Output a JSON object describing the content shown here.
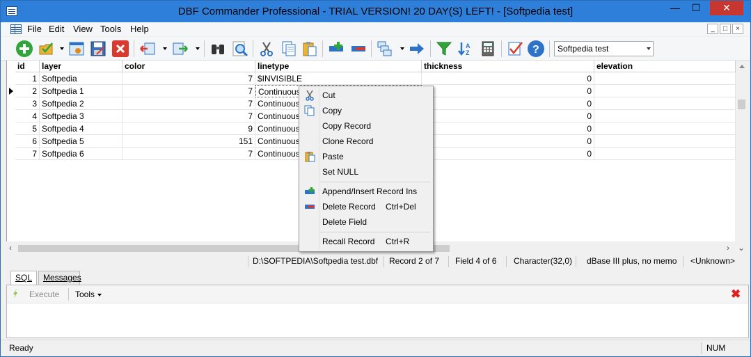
{
  "window": {
    "title": "DBF Commander Professional - TRIAL VERSION! 20 DAY(S) LEFT! - [Softpedia test]",
    "min_glyph": "—",
    "max_glyph": "☐",
    "close_glyph": "✕"
  },
  "menu": {
    "items": [
      "File",
      "Edit",
      "View",
      "Tools",
      "Help"
    ],
    "mdi": [
      "_",
      "□",
      "×"
    ]
  },
  "toolbar": {
    "table_select": "Softpedia test",
    "icons": [
      "new-record-icon",
      "open-icon",
      "properties-icon",
      "save-icon",
      "close-table-icon",
      "import-icon",
      "export-icon",
      "find-icon",
      "zoom-icon",
      "cut-icon",
      "copy-icon",
      "paste-icon",
      "append-record-icon",
      "delete-record-icon",
      "copy-structure-icon",
      "go-icon",
      "filter-icon",
      "sort-icon",
      "calculator-icon",
      "check-icon",
      "help-icon"
    ]
  },
  "grid": {
    "columns": [
      "id",
      "layer",
      "color",
      "linetype",
      "thickness",
      "elevation"
    ],
    "rows": [
      {
        "id": "1",
        "layer": "Softpedia",
        "color": "7",
        "linetype": "$INVISIBLE",
        "thickness": "0",
        "elevation": ""
      },
      {
        "id": "2",
        "layer": "Softpedia 1",
        "color": "7",
        "linetype": "Continuous",
        "thickness": "0",
        "elevation": ""
      },
      {
        "id": "3",
        "layer": "Softpedia 2",
        "color": "7",
        "linetype": "Continuous",
        "thickness": "0",
        "elevation": ""
      },
      {
        "id": "4",
        "layer": "Softpedia 3",
        "color": "7",
        "linetype": "Continuous",
        "thickness": "0",
        "elevation": ""
      },
      {
        "id": "5",
        "layer": "Softpedia 4",
        "color": "9",
        "linetype": "Continuous",
        "thickness": "0",
        "elevation": ""
      },
      {
        "id": "6",
        "layer": "Softpedia 5",
        "color": "151",
        "linetype": "Continuous",
        "thickness": "0",
        "elevation": ""
      },
      {
        "id": "7",
        "layer": "Softpedia 6",
        "color": "7",
        "linetype": "Continuous",
        "thickness": "0",
        "elevation": ""
      }
    ],
    "current_row": 2
  },
  "info": {
    "path": "D:\\SOFTPEDIA\\Softpedia test.dbf",
    "record": "Record 2 of 7",
    "field": "Field 4 of 6",
    "type": "Character(32,0)",
    "format": "dBase III plus, no memo",
    "codepage": "<Unknown>"
  },
  "lower": {
    "tabs": [
      "SQL",
      "Messages"
    ],
    "execute": "Execute",
    "tools": "Tools",
    "close_glyph": "✖"
  },
  "status": {
    "ready": "Ready",
    "num": "NUM"
  },
  "context_menu": {
    "items": [
      {
        "label": "Cut",
        "shortcut": "",
        "icon": "cut-icon"
      },
      {
        "label": "Copy",
        "shortcut": "",
        "icon": "copy-icon"
      },
      {
        "label": "Copy Record",
        "shortcut": "",
        "icon": ""
      },
      {
        "label": "Clone Record",
        "shortcut": "",
        "icon": ""
      },
      {
        "label": "Paste",
        "shortcut": "",
        "icon": "paste-icon"
      },
      {
        "label": "Set NULL",
        "shortcut": "",
        "icon": ""
      },
      {
        "label": "Append/Insert Record Ins",
        "shortcut": "",
        "icon": "append-record-icon"
      },
      {
        "label": "Delete Record",
        "shortcut": "Ctrl+Del",
        "icon": "delete-record-icon"
      },
      {
        "label": "Delete Field",
        "shortcut": "",
        "icon": ""
      },
      {
        "label": "Recall Record",
        "shortcut": "Ctrl+R",
        "icon": ""
      }
    ]
  },
  "colors": {
    "titlebar": "#2e7fd9",
    "close_button": "#c7372f",
    "accent_green": "#2fa53a",
    "accent_red": "#d83a2e",
    "accent_blue": "#2d74c9"
  }
}
